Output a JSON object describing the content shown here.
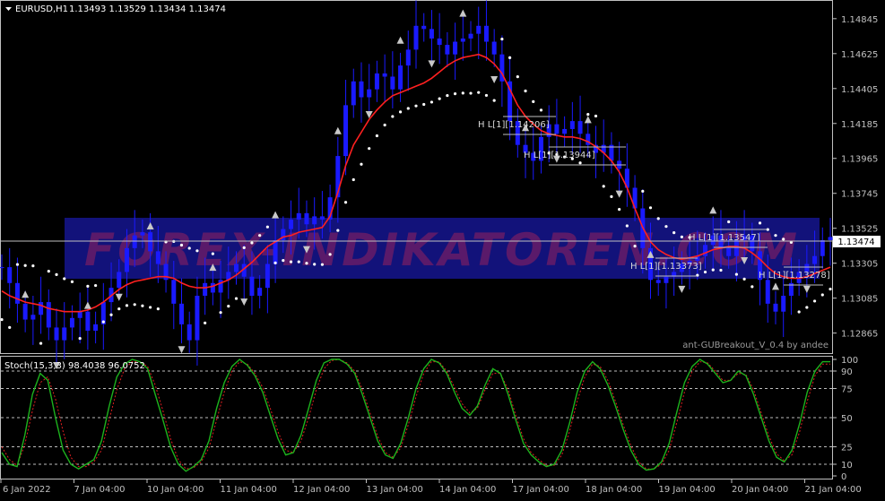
{
  "header": {
    "symbol": "EURUSD,H1",
    "quote": "1.13493 1.13529 1.13434 1.13474"
  },
  "watermark": "FOREX-INDIKATOREN.COM",
  "signature": "ant-GUBreakout_V_0.4 by andee",
  "stoch_header": "Stoch(15,3,3) 98.4038 96.0752",
  "current_price_label": "1.13474",
  "breakout_labels": [
    "H L[1][1.14206]",
    "H L[1][1.13944]",
    "H L[1][1.13547]",
    "H L[1][1.13373]",
    "H L[1][1.13278]"
  ],
  "colors": {
    "candles": "#1a1aff",
    "ma": "#ff2020",
    "dots": "#ffffff",
    "stoch_main": "#1db31d",
    "stoch_signal": "#e02020",
    "axis": "#c0c0c0",
    "watermark_box": "#12127a",
    "watermark_text": "#5a1a6a"
  },
  "chart_data": [
    {
      "type": "line",
      "name": "price",
      "ylim": [
        1.1275,
        1.1494
      ],
      "yticks": [
        "1.14845",
        "1.14625",
        "1.14405",
        "1.14185",
        "1.13965",
        "1.13745",
        "1.13525",
        "1.13305",
        "1.13085",
        "1.12865"
      ],
      "xticks": [
        "6 Jan 2022",
        "7 Jan 04:00",
        "10 Jan 04:00",
        "11 Jan 04:00",
        "12 Jan 04:00",
        "13 Jan 04:00",
        "14 Jan 04:00",
        "17 Jan 04:00",
        "18 Jan 04:00",
        "19 Jan 04:00",
        "20 Jan 04:00",
        "21 Jan 04:00"
      ],
      "close": [
        1.1328,
        1.1318,
        1.1305,
        1.1295,
        1.1298,
        1.1306,
        1.129,
        1.1282,
        1.129,
        1.1296,
        1.13,
        1.1288,
        1.1292,
        1.1306,
        1.1315,
        1.1325,
        1.134,
        1.1348,
        1.135,
        1.1338,
        1.133,
        1.132,
        1.1305,
        1.1292,
        1.1282,
        1.131,
        1.1318,
        1.1312,
        1.132,
        1.1325,
        1.133,
        1.1322,
        1.131,
        1.1315,
        1.133,
        1.1345,
        1.1352,
        1.1358,
        1.1362,
        1.1355,
        1.136,
        1.1358,
        1.1372,
        1.1398,
        1.143,
        1.1445,
        1.1435,
        1.144,
        1.145,
        1.1448,
        1.144,
        1.1455,
        1.1465,
        1.148,
        1.1478,
        1.1472,
        1.1468,
        1.1462,
        1.147,
        1.1472,
        1.1475,
        1.148,
        1.147,
        1.1462,
        1.1445,
        1.142,
        1.1405,
        1.14,
        1.1395,
        1.141,
        1.1418,
        1.1412,
        1.1415,
        1.142,
        1.1412,
        1.1405,
        1.14,
        1.1405,
        1.1395,
        1.139,
        1.1378,
        1.1365,
        1.134,
        1.132,
        1.1318,
        1.1322,
        1.1325,
        1.133,
        1.1332,
        1.1335,
        1.1342,
        1.1348,
        1.134,
        1.1335,
        1.1345,
        1.1348,
        1.1338,
        1.132,
        1.1305,
        1.13,
        1.131,
        1.1318,
        1.1325,
        1.133,
        1.1335,
        1.1345,
        1.1347
      ],
      "ma": [
        1.1313,
        1.131,
        1.1308,
        1.1306,
        1.1305,
        1.1304,
        1.1302,
        1.1301,
        1.13,
        1.13,
        1.13,
        1.1301,
        1.1303,
        1.1306,
        1.131,
        1.1314,
        1.1317,
        1.1319,
        1.132,
        1.1321,
        1.1322,
        1.1322,
        1.1321,
        1.1318,
        1.1316,
        1.1315,
        1.1315,
        1.1316,
        1.1318,
        1.132,
        1.1323,
        1.1327,
        1.1331,
        1.1336,
        1.1341,
        1.1344,
        1.1347,
        1.1348,
        1.135,
        1.1351,
        1.1352,
        1.1353,
        1.136,
        1.1375,
        1.1392,
        1.1405,
        1.1413,
        1.1421,
        1.1427,
        1.1432,
        1.1436,
        1.1438,
        1.144,
        1.1442,
        1.1444,
        1.1447,
        1.1451,
        1.1455,
        1.1458,
        1.146,
        1.1461,
        1.1462,
        1.146,
        1.1456,
        1.145,
        1.144,
        1.143,
        1.1423,
        1.1418,
        1.1414,
        1.1412,
        1.1411,
        1.141,
        1.141,
        1.1409,
        1.1407,
        1.1404,
        1.14,
        1.1395,
        1.1388,
        1.1378,
        1.1365,
        1.1353,
        1.1344,
        1.1339,
        1.1336,
        1.1334,
        1.1333,
        1.1334,
        1.1335,
        1.1337,
        1.1339,
        1.134,
        1.1341,
        1.1341,
        1.134,
        1.1337,
        1.1333,
        1.1328,
        1.1324,
        1.1322,
        1.1321,
        1.1321,
        1.1322,
        1.1324,
        1.1326,
        1.1328
      ]
    },
    {
      "type": "line",
      "name": "stochastic",
      "ylim": [
        0,
        100
      ],
      "yticks": [
        "100",
        "90",
        "75",
        "50",
        "25",
        "10",
        "0"
      ],
      "levels": [
        90,
        75,
        50,
        25,
        10
      ],
      "main": [
        20,
        10,
        8,
        35,
        70,
        88,
        82,
        50,
        22,
        10,
        6,
        10,
        14,
        30,
        60,
        85,
        96,
        100,
        98,
        92,
        70,
        48,
        25,
        10,
        4,
        8,
        14,
        30,
        58,
        80,
        94,
        100,
        95,
        86,
        72,
        52,
        32,
        18,
        20,
        35,
        58,
        82,
        97,
        100,
        100,
        96,
        88,
        70,
        50,
        30,
        18,
        15,
        28,
        50,
        75,
        92,
        100,
        97,
        88,
        72,
        58,
        52,
        60,
        78,
        92,
        88,
        70,
        48,
        28,
        18,
        12,
        8,
        10,
        22,
        45,
        72,
        90,
        98,
        92,
        78,
        60,
        40,
        22,
        10,
        5,
        6,
        12,
        28,
        55,
        80,
        94,
        100,
        96,
        88,
        80,
        82,
        90,
        86,
        70,
        50,
        30,
        16,
        12,
        22,
        45,
        72,
        90,
        98,
        98
      ],
      "signal": [
        25,
        14,
        9,
        27,
        56,
        80,
        85,
        66,
        38,
        16,
        8,
        8,
        12,
        22,
        48,
        74,
        92,
        98,
        98,
        94,
        78,
        56,
        32,
        14,
        6,
        7,
        12,
        24,
        48,
        72,
        90,
        98,
        96,
        88,
        76,
        58,
        38,
        22,
        20,
        30,
        50,
        74,
        92,
        99,
        100,
        97,
        90,
        74,
        54,
        34,
        20,
        16,
        24,
        44,
        68,
        88,
        98,
        98,
        90,
        76,
        62,
        54,
        58,
        74,
        88,
        88,
        74,
        52,
        32,
        20,
        14,
        9,
        9,
        18,
        38,
        64,
        85,
        96,
        94,
        82,
        64,
        44,
        26,
        12,
        6,
        6,
        10,
        22,
        46,
        72,
        90,
        98,
        97,
        90,
        82,
        82,
        88,
        87,
        74,
        54,
        34,
        19,
        13,
        18,
        38,
        64,
        86,
        96,
        96
      ]
    }
  ]
}
